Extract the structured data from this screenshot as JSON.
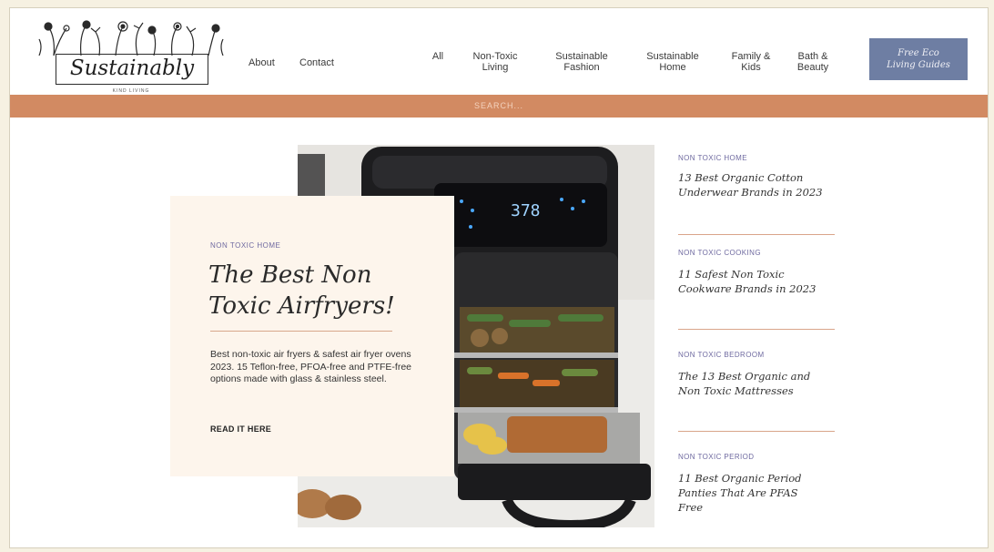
{
  "header": {
    "logo_text": "Sustainably",
    "logo_subtext": "KIND LIVING",
    "nav_left": [
      "About",
      "Contact"
    ],
    "nav_categories": [
      [
        "All",
        ""
      ],
      [
        "Non-Toxic",
        "Living"
      ],
      [
        "Sustainable",
        "Fashion"
      ],
      [
        "Sustainable",
        "Home"
      ],
      [
        "Family &",
        "Kids"
      ],
      [
        "Bath &",
        "Beauty"
      ]
    ],
    "cta": [
      "Free Eco",
      "Living Guides"
    ]
  },
  "search": {
    "label": "SEARCH..."
  },
  "hero": {
    "airfryer_display": "378",
    "category": "NON TOXIC HOME",
    "title": "The Best Non Toxic Airfryers!",
    "description": "Best non-toxic air fryers & safest air fryer ovens 2023. 15 Teflon-free, PFOA-free and PTFE-free options made with glass & stainless steel.",
    "read_more": "READ IT HERE"
  },
  "sidebar": [
    {
      "category": "NON TOXIC HOME",
      "title": "13 Best Organic Cotton Underwear Brands in 2023"
    },
    {
      "category": "NON TOXIC COOKING",
      "title": "11 Safest Non Toxic Cookware Brands in 2023"
    },
    {
      "category": "NON TOXIC BEDROOM",
      "title": "The 13 Best Organic and Non Toxic Mattresses"
    },
    {
      "category": "NON TOXIC PERIOD",
      "title": "11 Best Organic Period Panties That Are PFAS Free"
    }
  ],
  "colors": {
    "search_bar": "#d28a62",
    "cta": "#6e7ea3",
    "card": "#fdf5ec",
    "category_text": "#6f6aa0",
    "divider": "#d9a58a"
  }
}
